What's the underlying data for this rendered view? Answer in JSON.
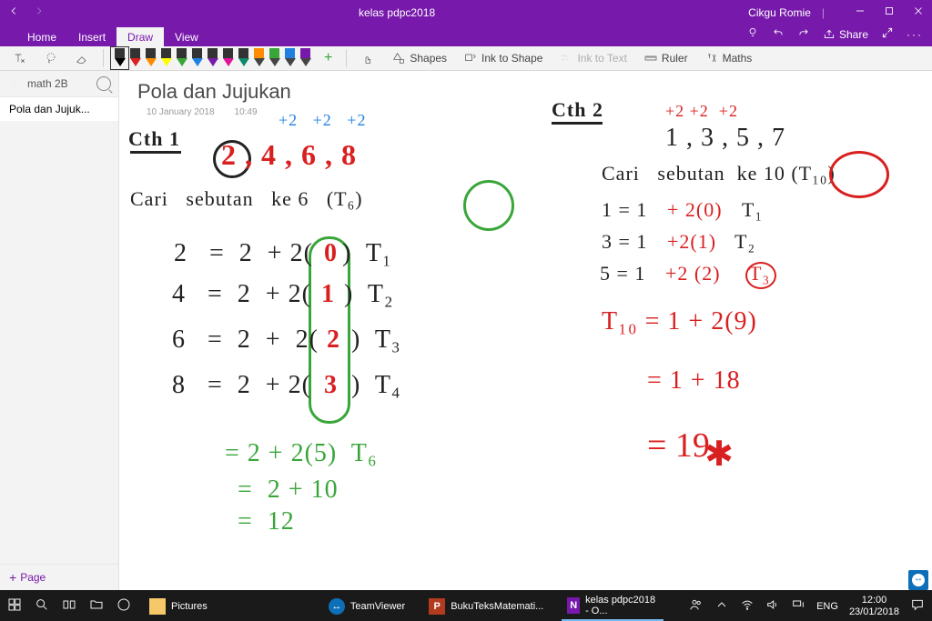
{
  "title_bar": {
    "document": "kelas pdpc2018",
    "user": "Cikgu Romie"
  },
  "tabs": [
    {
      "name": "Home",
      "active": false
    },
    {
      "name": "Insert",
      "active": false
    },
    {
      "name": "Draw",
      "active": true
    },
    {
      "name": "View",
      "active": false
    }
  ],
  "ribbon": {
    "shapes_label": "Shapes",
    "ink_to_shape_label": "Ink to Shape",
    "ink_to_text_label": "Ink to Text",
    "ruler_label": "Ruler",
    "maths_label": "Maths"
  },
  "sidebar": {
    "section": "math 2B",
    "pages": [
      {
        "label": "Pola dan Jujuk...",
        "active": true
      }
    ],
    "add_label": "Page"
  },
  "page": {
    "title": "Pola dan Jujukan",
    "date": "10 January 2018",
    "time": "10:49"
  },
  "ink": {
    "ex1_head": "Cth 1",
    "ex1_diff": "+2   +2   +2",
    "ex1_seq": "2 , 4 , 6 , 8",
    "ex1_prompt": "Cari   sebutan   ke 6   (T₆)",
    "ex1_l1_left": "2   =  2  + 2(",
    "ex1_l1_mid": "0",
    "ex1_l1_right": ")  T₁",
    "ex1_l2_left": "4   =  2  + 2(",
    "ex1_l2_mid": "1",
    "ex1_l2_right": ")  T₂",
    "ex1_l3_left": "6   =  2  +  2(",
    "ex1_l3_mid": "2",
    "ex1_l3_right": ")  T₃",
    "ex1_l4_left": "8   =  2  + 2(",
    "ex1_l4_mid": "3",
    "ex1_l4_right": ")  T₄",
    "ex1_ans1": "= 2 + 2(5)  T₆",
    "ex1_ans2": "=  2 + 10",
    "ex1_ans3": "=  12",
    "ex2_head": "Cth 2",
    "ex2_diff": "+2 +2  +2",
    "ex2_seq": "1 , 3 , 5 , 7",
    "ex2_prompt": "Cari   sebutan  ke 10 (T₁₀)",
    "ex2_l1_a": "1 = 1",
    "ex2_l1_b": "+ 2(0)",
    "ex2_l1_c": "T₁",
    "ex2_l2_a": "3 = 1",
    "ex2_l2_b": "+2(1)",
    "ex2_l2_c": "T₂",
    "ex2_l3_a": "5 = 1",
    "ex2_l3_b": "+2 (2)",
    "ex2_l3_c": "T₃",
    "ex2_ans1": "T₁₀ = 1 + 2(9)",
    "ex2_ans2": "= 1 + 18",
    "ex2_ans3": "= 19"
  },
  "taskbar": {
    "apps": [
      {
        "label": "",
        "icon": "win"
      },
      {
        "label": "",
        "icon": "search"
      },
      {
        "label": "",
        "icon": "task"
      },
      {
        "label": "",
        "icon": "explorer"
      },
      {
        "label": "",
        "icon": "edge"
      },
      {
        "label": "Pictures",
        "icon": "explorer",
        "bg": "#fff"
      },
      {
        "label": "",
        "gap": true
      },
      {
        "label": "TeamViewer",
        "icon": "tv",
        "bg": "#0d6fb8"
      },
      {
        "label": "BukuTeksMatemati...",
        "icon": "pdf",
        "bg": "#a52a2a"
      },
      {
        "label": "kelas pdpc2018 - O...",
        "icon": "one",
        "bg": "#7719aa",
        "active": true
      }
    ],
    "lang": "ENG",
    "time": "12:00",
    "date": "23/01/2018"
  }
}
